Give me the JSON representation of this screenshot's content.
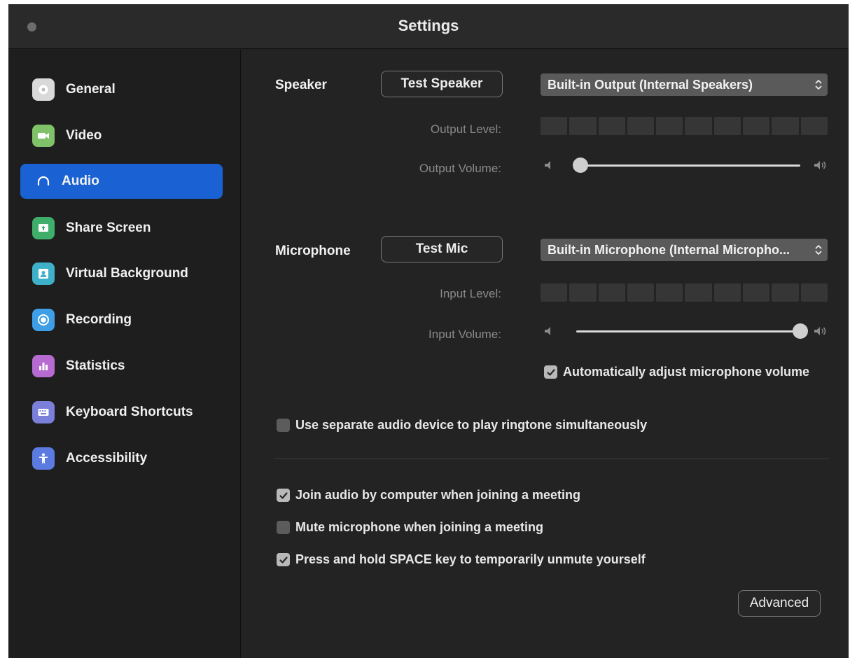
{
  "window": {
    "title": "Settings"
  },
  "sidebar": {
    "items": [
      {
        "label": "General",
        "icon": "gear-icon",
        "color": "#d9d9d9"
      },
      {
        "label": "Video",
        "icon": "video-camera-icon",
        "color": "#7fc26a"
      },
      {
        "label": "Audio",
        "icon": "headphones-icon",
        "color": "#1a62d4",
        "selected": true
      },
      {
        "label": "Share Screen",
        "icon": "share-screen-icon",
        "color": "#3fae6a"
      },
      {
        "label": "Virtual Background",
        "icon": "virtual-background-icon",
        "color": "#3fb0c9"
      },
      {
        "label": "Recording",
        "icon": "record-icon",
        "color": "#3f9fe6"
      },
      {
        "label": "Statistics",
        "icon": "bar-chart-icon",
        "color": "#b76bd1"
      },
      {
        "label": "Keyboard Shortcuts",
        "icon": "keyboard-icon",
        "color": "#7a7fd9"
      },
      {
        "label": "Accessibility",
        "icon": "accessibility-icon",
        "color": "#5b7be0"
      }
    ]
  },
  "speaker": {
    "label": "Speaker",
    "test_button": "Test Speaker",
    "device": "Built-in Output (Internal Speakers)",
    "output_level_label": "Output Level:",
    "output_level": 0,
    "output_volume_label": "Output Volume:",
    "output_volume": 0.02
  },
  "microphone": {
    "label": "Microphone",
    "test_button": "Test Mic",
    "device": "Built-in Microphone (Internal Micropho...",
    "input_level_label": "Input Level:",
    "input_level": 0,
    "input_volume_label": "Input Volume:",
    "input_volume": 1.0,
    "auto_adjust_label": "Automatically adjust microphone volume",
    "auto_adjust_checked": true
  },
  "options": {
    "separate_ringtone": {
      "label": "Use separate audio device to play ringtone simultaneously",
      "checked": false
    },
    "join_audio": {
      "label": "Join audio by computer when joining a meeting",
      "checked": true
    },
    "mute_on_join": {
      "label": "Mute microphone when joining a meeting",
      "checked": false
    },
    "space_to_unmute": {
      "label": "Press and hold SPACE key to temporarily unmute yourself",
      "checked": true
    }
  },
  "advanced_button": "Advanced",
  "colors": {
    "accent": "#1a62d4",
    "background": "#232323",
    "sidebar": "#1e1e1e"
  }
}
